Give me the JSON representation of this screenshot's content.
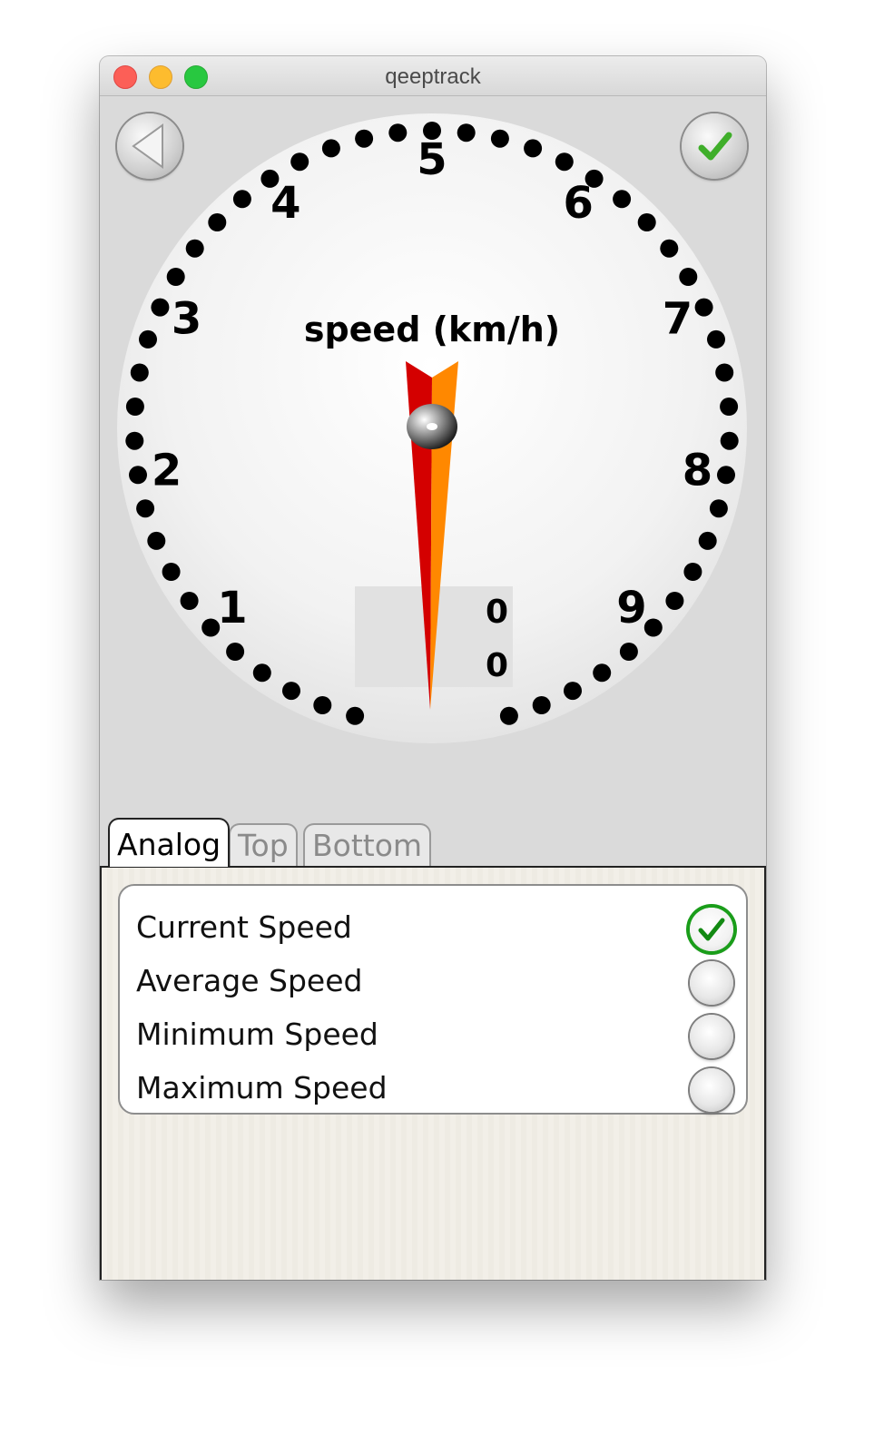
{
  "window": {
    "title": "qeeptrack"
  },
  "toolbar": {
    "back_icon": "back-triangle-icon",
    "confirm_icon": "checkmark-icon"
  },
  "gauge": {
    "label": "speed (km/h)",
    "scale_labels": [
      "1",
      "2",
      "3",
      "4",
      "5",
      "6",
      "7",
      "8",
      "9"
    ],
    "needle_value": 0,
    "readout_top": "0",
    "readout_bottom": "0",
    "needle_colors": {
      "left": "#d40000",
      "right": "#ff8800"
    }
  },
  "tabs": [
    {
      "label": "Analog",
      "active": true
    },
    {
      "label": "Top",
      "active": false
    },
    {
      "label": "Bottom",
      "active": false
    }
  ],
  "options": [
    {
      "label": "Current Speed",
      "checked": true
    },
    {
      "label": "Average Speed",
      "checked": false
    },
    {
      "label": "Minimum Speed",
      "checked": false
    },
    {
      "label": "Maximum Speed",
      "checked": false
    }
  ]
}
